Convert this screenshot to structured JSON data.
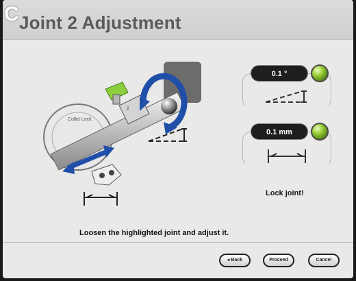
{
  "header": {
    "corner_letter": "C",
    "title": "Joint 2 Adjustment"
  },
  "indicators": {
    "angle_value": "0.1 °",
    "distance_value": "0.1 mm",
    "status_color": "#8fc43a"
  },
  "illustration": {
    "collar_text": "Collet Lock",
    "joint_label": "2"
  },
  "lock_message": "Lock joint!",
  "instruction": "Loosen the highlighted joint and adjust it.",
  "buttons": {
    "back": "◂ Back",
    "proceed": "Proceed",
    "cancel": "Cancel"
  }
}
